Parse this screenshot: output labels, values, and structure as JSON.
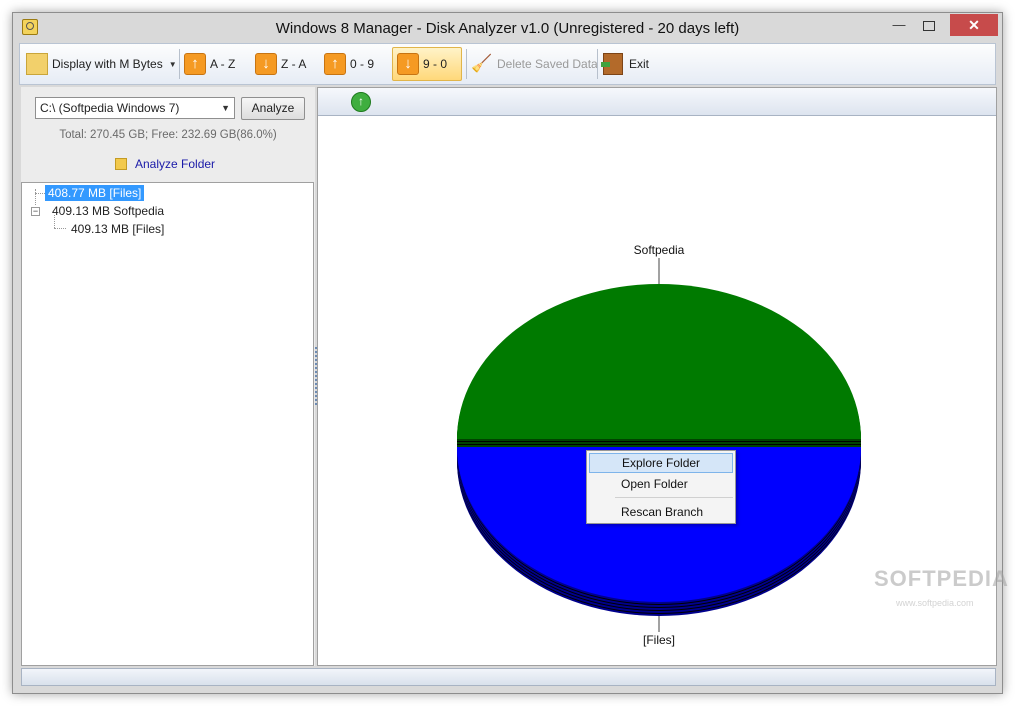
{
  "window": {
    "title": "Windows 8 Manager - Disk Analyzer v1.0 (Unregistered - 20 days left)"
  },
  "titlebar": {
    "close_symbol": "✕",
    "minimize_symbol": "—"
  },
  "toolbar": {
    "display_label": "Display with M Bytes",
    "sort_az": "A - Z",
    "sort_za": "Z - A",
    "sort_09": "0 - 9",
    "sort_90": "9 - 0",
    "delete_saved": "Delete Saved Data",
    "exit": "Exit",
    "up_arrow": "↑",
    "down_arrow": "↓"
  },
  "left": {
    "drive": "C:\\ (Softpedia Windows 7)",
    "analyze_button": "Analyze",
    "disk_info": "Total: 270.45 GB; Free: 232.69 GB(86.0%)",
    "analyze_folder": "Analyze Folder"
  },
  "tree": {
    "items": [
      {
        "label": "408.77 MB [Files]",
        "selected": true
      },
      {
        "label": "409.13 MB Softpedia",
        "expander": "−"
      },
      {
        "label": "409.13 MB [Files]"
      }
    ]
  },
  "right": {
    "up_symbol": "↑"
  },
  "chart_data": {
    "type": "pie",
    "categories": [
      "Softpedia",
      "[Files]"
    ],
    "values": [
      50,
      50
    ],
    "colors": [
      "#007a00",
      "#0000ff"
    ],
    "style": "3d-tilted"
  },
  "context_menu": {
    "items": [
      "Explore Folder",
      "Open Folder",
      "Rescan Branch"
    ],
    "highlighted": 0
  },
  "watermark": {
    "main": "SOFTPEDIA",
    "sub": "www.softpedia.com"
  }
}
